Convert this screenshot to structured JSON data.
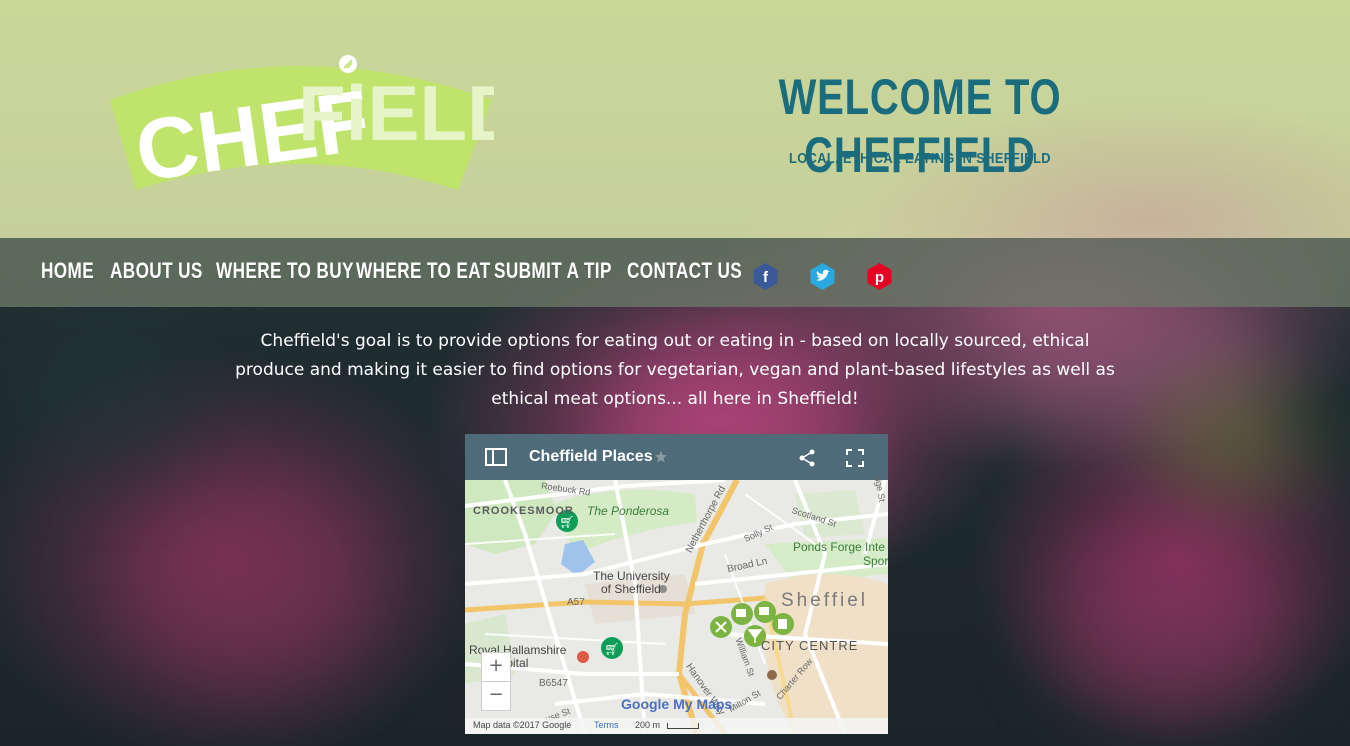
{
  "brand": {
    "logo_text": "CHEFFiELD",
    "accent": "#1b6c7c",
    "logo_green": "#b9e06a"
  },
  "hero": {
    "title": "WELCOME TO CHEFFIELD",
    "tagline": "LOCAL, ETHICAL EATING IN SHEFFIELD"
  },
  "nav": {
    "items": [
      {
        "label": "HOME"
      },
      {
        "label": "ABOUT US"
      },
      {
        "label": "WHERE TO BUY"
      },
      {
        "label": "WHERE TO EAT"
      },
      {
        "label": "SUBMIT A TIP"
      },
      {
        "label": "CONTACT US"
      }
    ],
    "social": [
      {
        "icon": "facebook-icon",
        "glyph": "f",
        "color": "#3b5998"
      },
      {
        "icon": "twitter-icon",
        "glyph": "t",
        "color": "#1da1f2"
      },
      {
        "icon": "pinterest-icon",
        "glyph": "p",
        "color": "#e60023"
      }
    ]
  },
  "intro": {
    "text": "Cheffield's goal is to provide options for eating out or eating in - based on locally sourced, ethical produce and making it easier to find options for vegetarian, vegan and plant-based lifestyles as well as ethical meat options... all here in Sheffield!"
  },
  "map": {
    "title": "Cheffield Places",
    "zoom_in": "+",
    "zoom_out": "−",
    "attribution": "Map data ©2017 Google",
    "terms": "Terms",
    "scale": "200 m",
    "google_label": "Google My Maps",
    "labels": {
      "crookesmoor": "CROOKESMOOR",
      "ponderosa": "The Ponderosa",
      "university_1": "The University",
      "university_2": "of Sheffield",
      "ponds_forge": "Ponds Forge Inte",
      "sport": "Spor",
      "sheffield": "Sheffiel",
      "city_centre": "CITY CENTRE",
      "hallamshire_1": "Royal Hallamshire",
      "hallamshire_2": "Hospital",
      "a57": "A57",
      "b6547": "B6547",
      "broad_ln": "Broad Ln",
      "netherthorpe": "Netherthorpe Rd",
      "roebuck": "Roebuck Rd",
      "scotland_st": "Scotland St",
      "solly_st": "Solly St",
      "hanover": "Hanover Way",
      "milton": "Milton St",
      "charter": "Charter Row",
      "william": "William St",
      "suse": "use St",
      "edge": "dge St"
    }
  }
}
